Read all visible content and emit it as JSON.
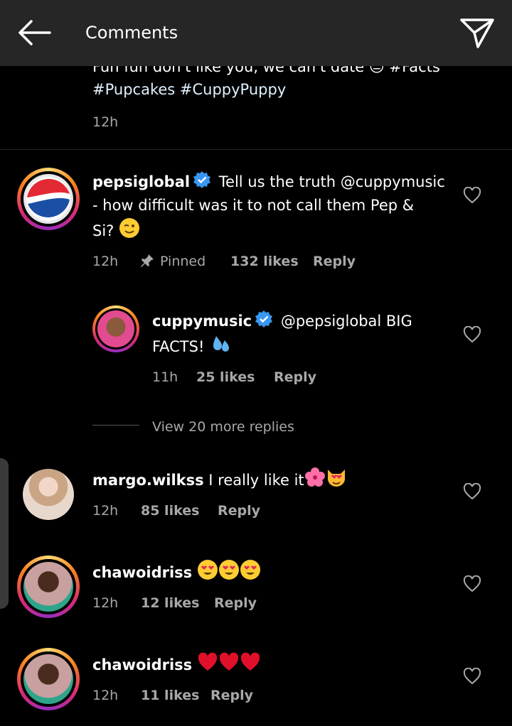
{
  "header": {
    "title": "Comments"
  },
  "top_caption": {
    "line1": "Fun fun don't like you, we can't date 😔 #Facts",
    "line2": "#Pupcakes #CuppyPuppy",
    "time": "12h"
  },
  "comments": [
    {
      "username": "pepsiglobal",
      "text1": "Tell us the truth @cuppymusic",
      "text2": "- how difficult was it to not call them Pep &",
      "text3": "Si?",
      "time": "12h",
      "pinned": "Pinned",
      "likes": "132 likes",
      "reply": "Reply"
    },
    {
      "username": "cuppymusic",
      "text1": "@pepsiglobal BIG",
      "text2": "FACTS!",
      "time": "11h",
      "likes": "25 likes",
      "reply": "Reply"
    },
    {
      "username": "margo.wilkss",
      "text1": "I really like it",
      "time": "12h",
      "likes": "85 likes",
      "reply": "Reply"
    },
    {
      "username": "chawoidriss",
      "time": "12h",
      "likes": "12 likes",
      "reply": "Reply"
    },
    {
      "username": "chawoidriss",
      "time": "12h",
      "likes": "11 likes",
      "reply": "Reply"
    }
  ],
  "view_more": "View 20 more replies",
  "icons": {
    "back": "arrow-left-icon",
    "send": "send-icon",
    "heart": "heart-outline-icon",
    "pin": "pin-icon",
    "verified": "verified-badge-icon"
  }
}
